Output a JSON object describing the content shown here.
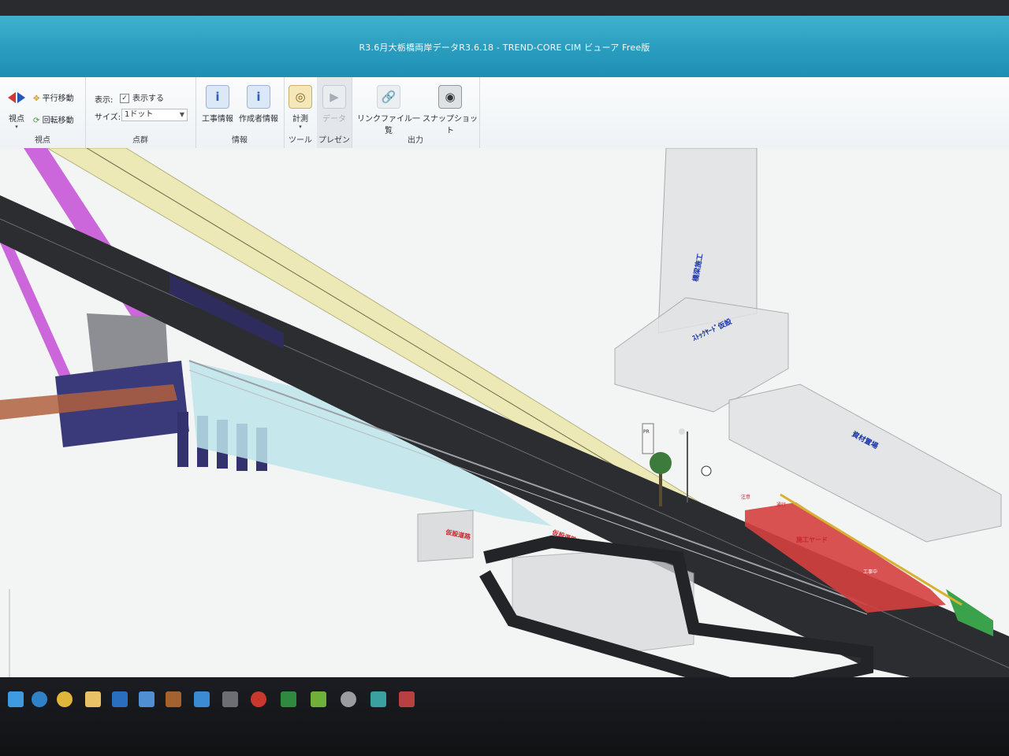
{
  "window": {
    "title": "R3.6月大栃橋両岸データR3.6.18 - TREND-CORE CIM ビューア Free版"
  },
  "ribbon": {
    "viewpoint_group": {
      "label": "視点",
      "viewpoint_button": "視点",
      "pan_button": "平行移動",
      "rotate_button": "回転移動"
    },
    "pointcloud_group": {
      "label": "点群",
      "display_label": "表示:",
      "display_checkbox": "表示する",
      "size_label": "サイズ:",
      "size_value": "1ドット"
    },
    "info_group": {
      "label": "情報",
      "construction_info": "工事情報",
      "author_info": "作成者情報"
    },
    "tool_group": {
      "label": "ツール",
      "measure": "計測"
    },
    "present_group": {
      "label": "プレゼン",
      "present_button": "データ"
    },
    "output_group": {
      "label": "出力",
      "link_files": "リンクファイル一覧",
      "snapshot": "スナップショット"
    }
  },
  "viewport": {
    "labels": {
      "tower_label": "橋梁施工",
      "box1_label": "ｽﾄｯｸﾔｰﾄﾞ仮設",
      "box2_label": "資材置場",
      "red_label1": "仮設道路",
      "red_label2": "仮設道路工事",
      "red_label3": "施工ヤード",
      "sign1": "PR",
      "sign2": "注意",
      "sign3": "通行",
      "sign4": "工事中"
    }
  },
  "colors": {
    "titlebar": "#2a9dbf",
    "road": "#2c2d30",
    "deck": "#ece9b6",
    "pier": "#34326e",
    "magenta": "#c656d8",
    "red_zone": "#d4403f",
    "ghost_box": "#d7dadd"
  },
  "taskbar": {
    "icons": [
      "windows-icon",
      "search-icon",
      "edge-icon",
      "chrome-icon",
      "explorer-icon",
      "outlook-icon",
      "store-icon",
      "app-icon",
      "app-icon",
      "app-icon",
      "app-icon",
      "app-icon",
      "app-icon",
      "powerpoint-icon",
      "app-icon",
      "excel-icon",
      "app-icon",
      "app-icon",
      "app-icon"
    ]
  }
}
